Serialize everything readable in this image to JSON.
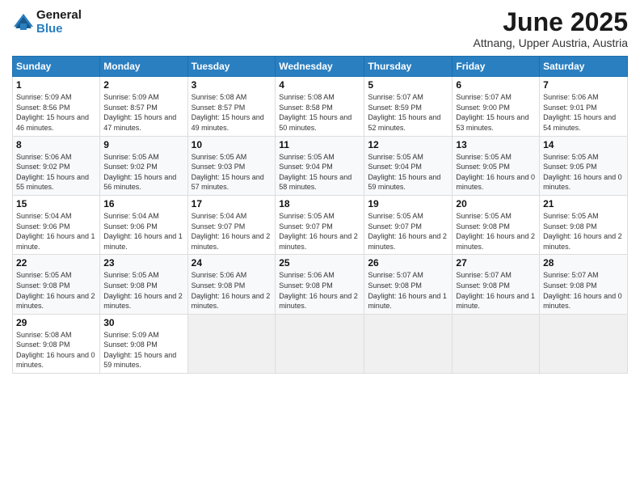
{
  "header": {
    "logo_line1": "General",
    "logo_line2": "Blue",
    "month": "June 2025",
    "location": "Attnang, Upper Austria, Austria"
  },
  "weekdays": [
    "Sunday",
    "Monday",
    "Tuesday",
    "Wednesday",
    "Thursday",
    "Friday",
    "Saturday"
  ],
  "weeks": [
    [
      {
        "day": 1,
        "rise": "5:09 AM",
        "set": "8:56 PM",
        "hours": "15 hours and 46 minutes."
      },
      {
        "day": 2,
        "rise": "5:09 AM",
        "set": "8:57 PM",
        "hours": "15 hours and 47 minutes."
      },
      {
        "day": 3,
        "rise": "5:08 AM",
        "set": "8:57 PM",
        "hours": "15 hours and 49 minutes."
      },
      {
        "day": 4,
        "rise": "5:08 AM",
        "set": "8:58 PM",
        "hours": "15 hours and 50 minutes."
      },
      {
        "day": 5,
        "rise": "5:07 AM",
        "set": "8:59 PM",
        "hours": "15 hours and 52 minutes."
      },
      {
        "day": 6,
        "rise": "5:07 AM",
        "set": "9:00 PM",
        "hours": "15 hours and 53 minutes."
      },
      {
        "day": 7,
        "rise": "5:06 AM",
        "set": "9:01 PM",
        "hours": "15 hours and 54 minutes."
      }
    ],
    [
      {
        "day": 8,
        "rise": "5:06 AM",
        "set": "9:02 PM",
        "hours": "15 hours and 55 minutes."
      },
      {
        "day": 9,
        "rise": "5:05 AM",
        "set": "9:02 PM",
        "hours": "15 hours and 56 minutes."
      },
      {
        "day": 10,
        "rise": "5:05 AM",
        "set": "9:03 PM",
        "hours": "15 hours and 57 minutes."
      },
      {
        "day": 11,
        "rise": "5:05 AM",
        "set": "9:04 PM",
        "hours": "15 hours and 58 minutes."
      },
      {
        "day": 12,
        "rise": "5:05 AM",
        "set": "9:04 PM",
        "hours": "15 hours and 59 minutes."
      },
      {
        "day": 13,
        "rise": "5:05 AM",
        "set": "9:05 PM",
        "hours": "16 hours and 0 minutes."
      },
      {
        "day": 14,
        "rise": "5:05 AM",
        "set": "9:05 PM",
        "hours": "16 hours and 0 minutes."
      }
    ],
    [
      {
        "day": 15,
        "rise": "5:04 AM",
        "set": "9:06 PM",
        "hours": "16 hours and 1 minute."
      },
      {
        "day": 16,
        "rise": "5:04 AM",
        "set": "9:06 PM",
        "hours": "16 hours and 1 minute."
      },
      {
        "day": 17,
        "rise": "5:04 AM",
        "set": "9:07 PM",
        "hours": "16 hours and 2 minutes."
      },
      {
        "day": 18,
        "rise": "5:05 AM",
        "set": "9:07 PM",
        "hours": "16 hours and 2 minutes."
      },
      {
        "day": 19,
        "rise": "5:05 AM",
        "set": "9:07 PM",
        "hours": "16 hours and 2 minutes."
      },
      {
        "day": 20,
        "rise": "5:05 AM",
        "set": "9:08 PM",
        "hours": "16 hours and 2 minutes."
      },
      {
        "day": 21,
        "rise": "5:05 AM",
        "set": "9:08 PM",
        "hours": "16 hours and 2 minutes."
      }
    ],
    [
      {
        "day": 22,
        "rise": "5:05 AM",
        "set": "9:08 PM",
        "hours": "16 hours and 2 minutes."
      },
      {
        "day": 23,
        "rise": "5:05 AM",
        "set": "9:08 PM",
        "hours": "16 hours and 2 minutes."
      },
      {
        "day": 24,
        "rise": "5:06 AM",
        "set": "9:08 PM",
        "hours": "16 hours and 2 minutes."
      },
      {
        "day": 25,
        "rise": "5:06 AM",
        "set": "9:08 PM",
        "hours": "16 hours and 2 minutes."
      },
      {
        "day": 26,
        "rise": "5:07 AM",
        "set": "9:08 PM",
        "hours": "16 hours and 1 minute."
      },
      {
        "day": 27,
        "rise": "5:07 AM",
        "set": "9:08 PM",
        "hours": "16 hours and 1 minute."
      },
      {
        "day": 28,
        "rise": "5:07 AM",
        "set": "9:08 PM",
        "hours": "16 hours and 0 minutes."
      }
    ],
    [
      {
        "day": 29,
        "rise": "5:08 AM",
        "set": "9:08 PM",
        "hours": "16 hours and 0 minutes."
      },
      {
        "day": 30,
        "rise": "5:09 AM",
        "set": "9:08 PM",
        "hours": "15 hours and 59 minutes."
      },
      null,
      null,
      null,
      null,
      null
    ]
  ]
}
